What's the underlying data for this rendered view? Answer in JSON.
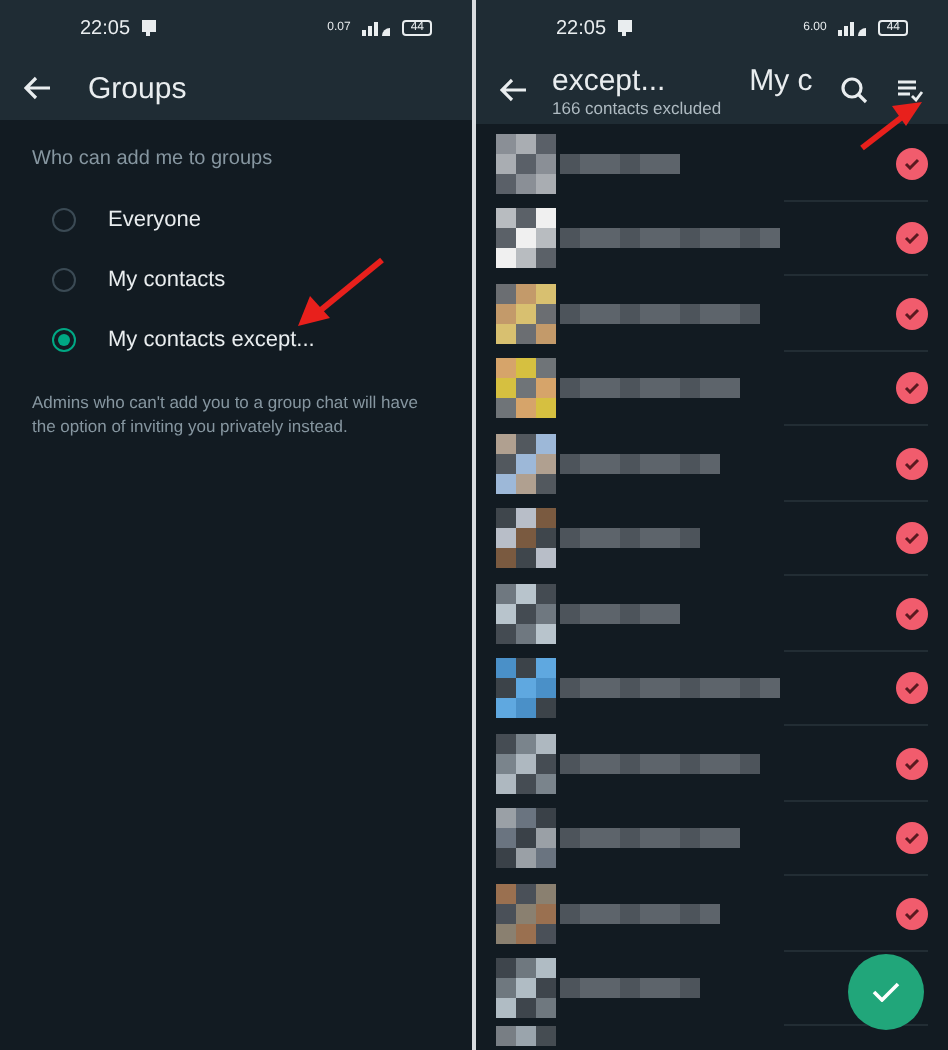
{
  "left_screen": {
    "status_bar": {
      "time": "22:05",
      "speed": "0.07",
      "battery": "44"
    },
    "header": {
      "title": "Groups"
    },
    "section_label": "Who can add me to groups",
    "options": [
      {
        "label": "Everyone",
        "selected": false
      },
      {
        "label": "My contacts",
        "selected": false
      },
      {
        "label": "My contacts except...",
        "selected": true
      }
    ],
    "note": "Admins who can't add you to a group chat will have the option of inviting you privately instead."
  },
  "right_screen": {
    "status_bar": {
      "time": "22:05",
      "speed": "6.00",
      "battery": "44"
    },
    "header": {
      "title": "except...",
      "title_2": "My c",
      "subtitle": "166 contacts excluded"
    },
    "contacts": [
      {
        "checked": true
      },
      {
        "checked": true
      },
      {
        "checked": true
      },
      {
        "checked": true
      },
      {
        "checked": true
      },
      {
        "checked": true
      },
      {
        "checked": true
      },
      {
        "checked": true
      },
      {
        "checked": true
      },
      {
        "checked": true
      },
      {
        "checked": true
      }
    ]
  }
}
